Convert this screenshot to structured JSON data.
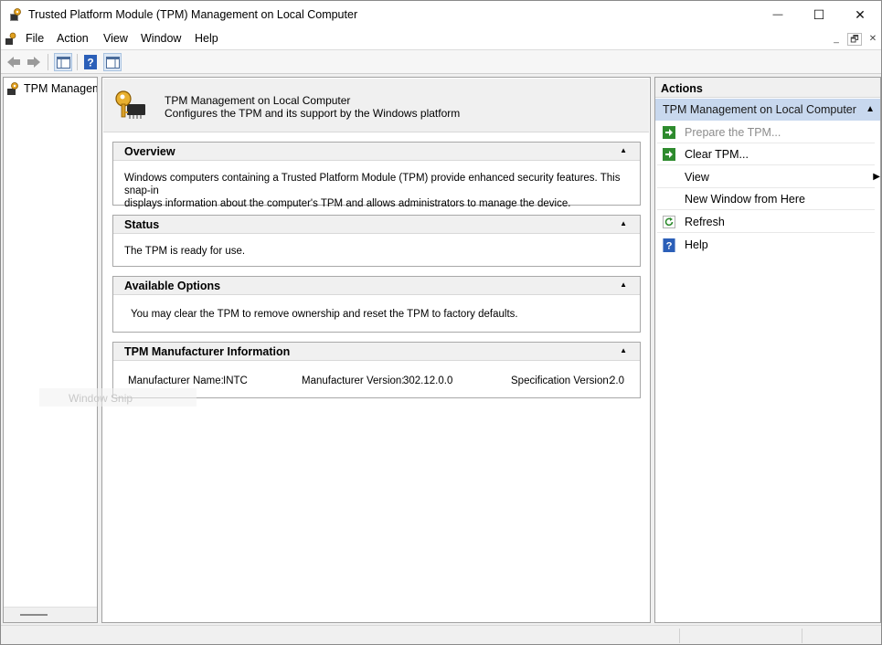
{
  "window": {
    "title": "Trusted Platform Module (TPM) Management on Local Computer",
    "minimize_glyph": "—",
    "maximize_glyph": "☐",
    "close_glyph": "✕"
  },
  "menu": {
    "items": [
      "File",
      "Action",
      "View",
      "Window",
      "Help"
    ],
    "mdi_minimize": "_",
    "mdi_restore": "🗗",
    "mdi_close": "✕"
  },
  "tree": {
    "root_label": "TPM Management on Local Computer"
  },
  "header": {
    "title": "TPM Management on Local Computer",
    "subtitle": "Configures the TPM and its support by the Windows platform"
  },
  "sections": {
    "overview": {
      "title": "Overview",
      "body_line1": "Windows computers containing a Trusted Platform Module (TPM) provide enhanced security features. This snap-in",
      "body_line2": "displays information about the computer's TPM and allows administrators to manage the device."
    },
    "status": {
      "title": "Status",
      "body": "The TPM is ready for use."
    },
    "options": {
      "title": "Available Options",
      "body": "You may clear the TPM to remove ownership and reset the TPM to factory defaults."
    },
    "manufacturer": {
      "title": "TPM Manufacturer Information",
      "name_label": "Manufacturer Name:",
      "name_value": "INTC",
      "version_label": "Manufacturer Version:",
      "version_value": "302.12.0.0",
      "spec_label": "Specification Version:",
      "spec_value": "2.0"
    },
    "toggle_glyph": "▲"
  },
  "ghost_tooltip": "Window Snip",
  "actions": {
    "header": "Actions",
    "group_label": "TPM Management on Local Computer",
    "group_arrow": "▲",
    "items": [
      {
        "label": "Prepare the TPM...",
        "icon": "green-arrow-icon",
        "disabled": true
      },
      {
        "label": "Clear TPM...",
        "icon": "green-arrow-icon",
        "disabled": false
      },
      {
        "label": "View",
        "icon": "",
        "disabled": false,
        "submenu": "▶"
      },
      {
        "label": "New Window from Here",
        "icon": "",
        "disabled": false
      },
      {
        "label": "Refresh",
        "icon": "refresh-icon",
        "disabled": false
      },
      {
        "label": "Help",
        "icon": "help-icon",
        "disabled": false
      }
    ]
  },
  "colors": {
    "accent_selection": "#c8d8ee",
    "action_arrow_green": "#2e8b2e",
    "help_blue": "#2b5fb8"
  }
}
